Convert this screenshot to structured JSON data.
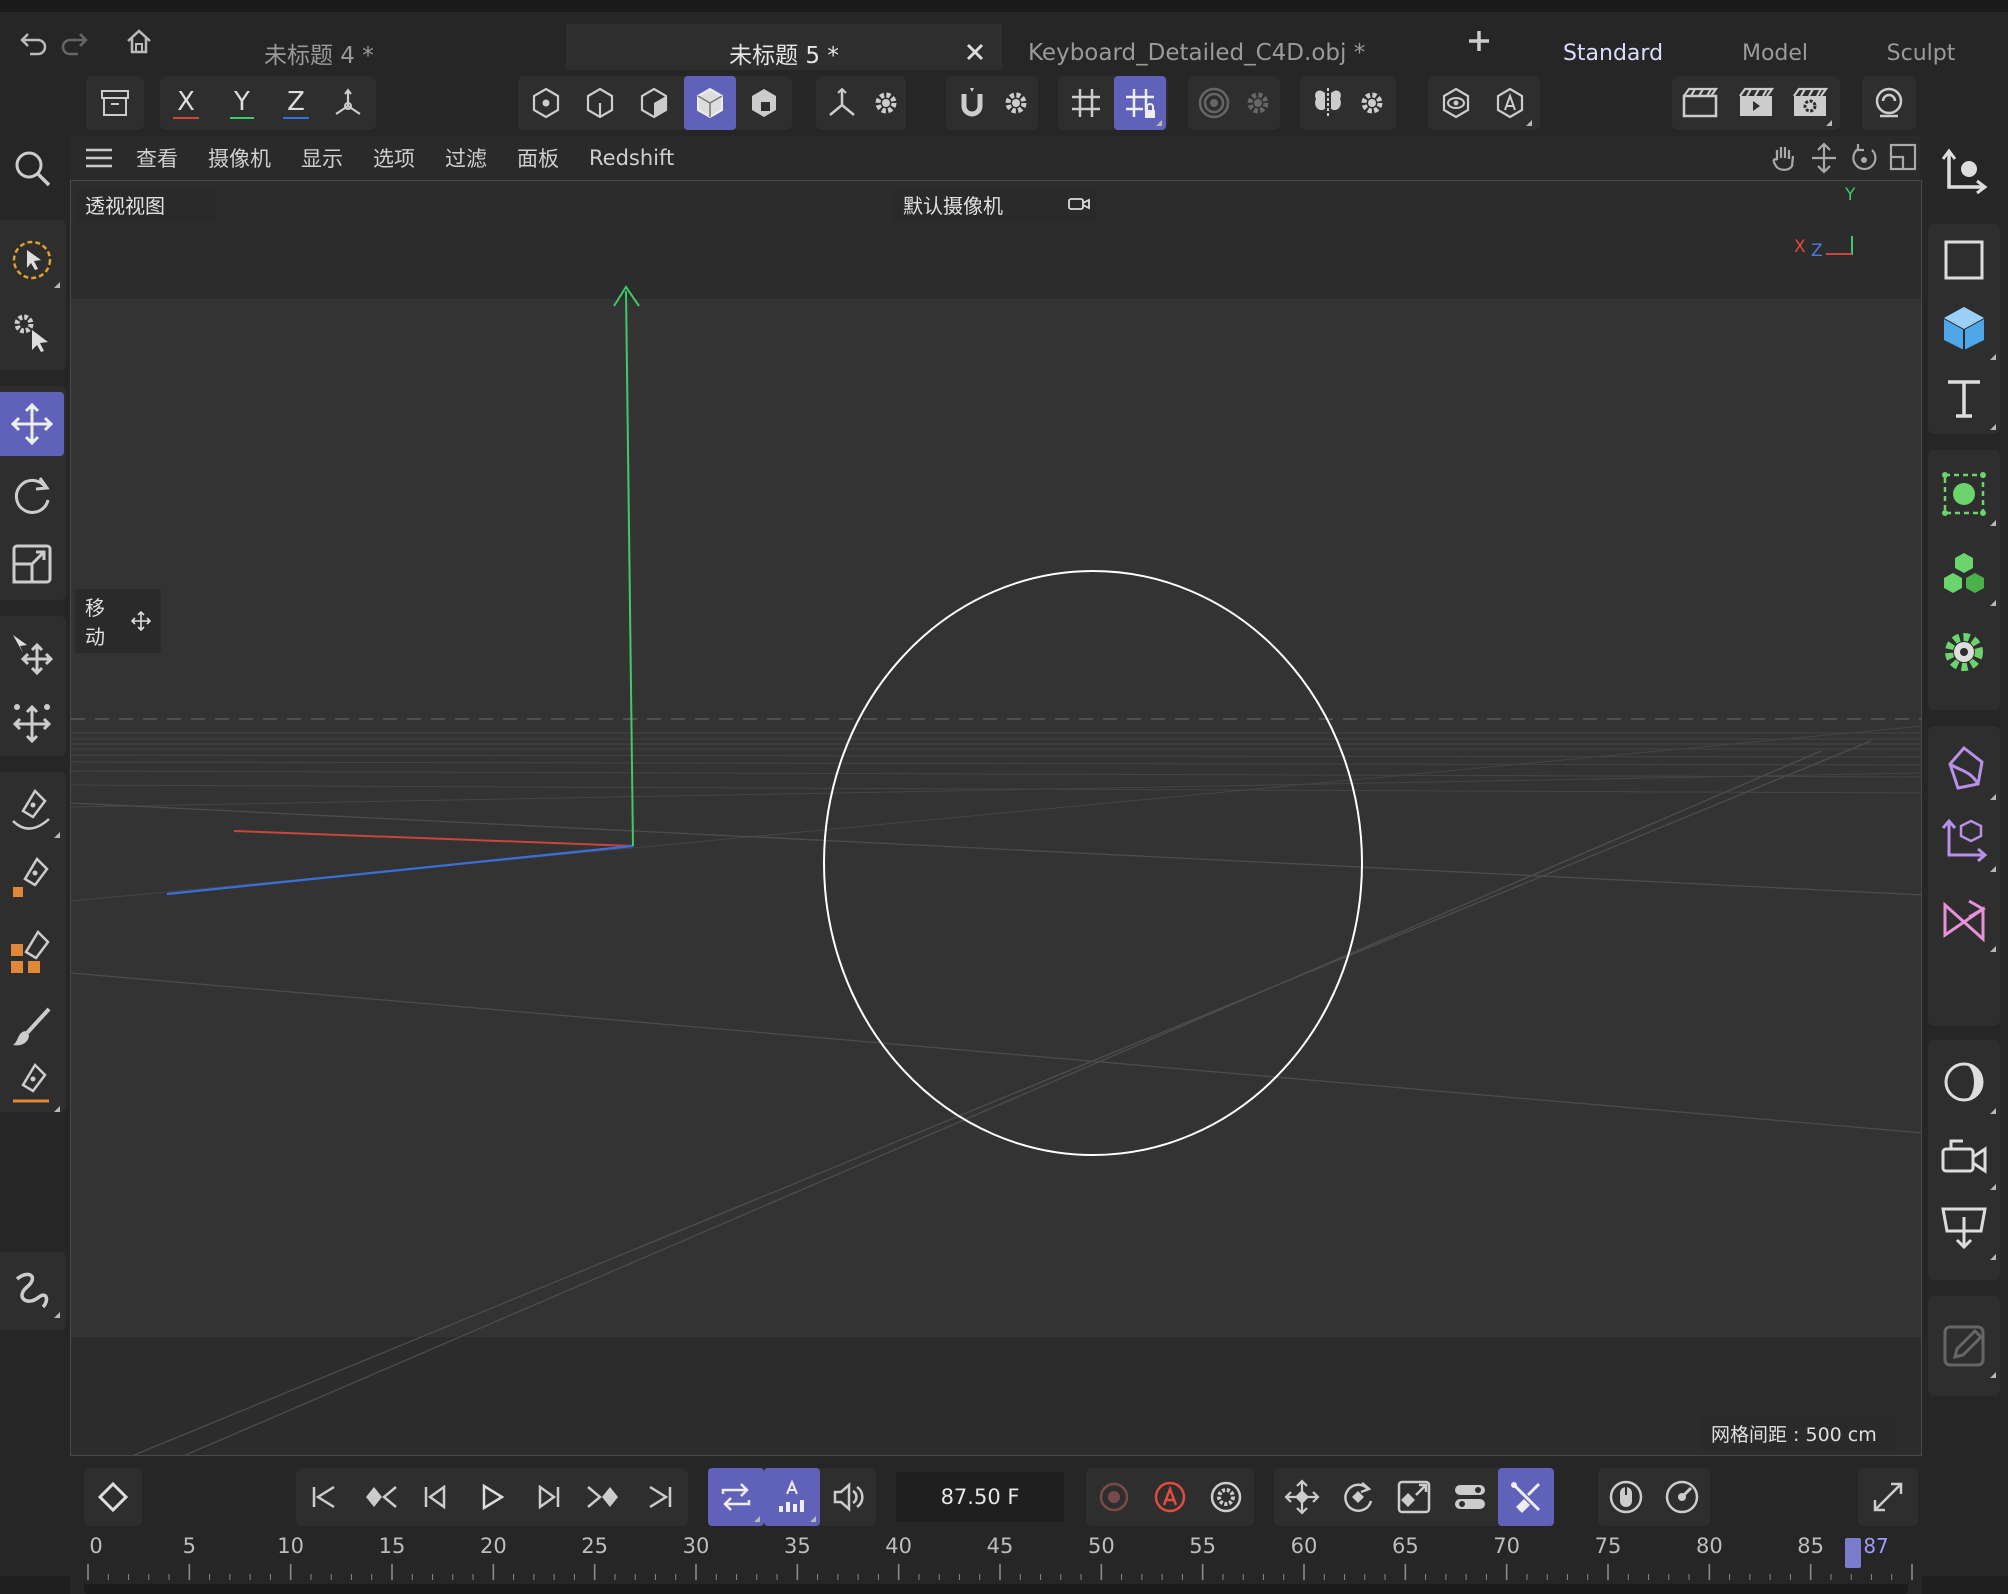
{
  "tabs": [
    {
      "label": "未标题 4 *"
    },
    {
      "label": "未标题 5 *"
    },
    {
      "label": "Keyboard_Detailed_C4D.obj *"
    }
  ],
  "layouts": [
    "Standard",
    "Model",
    "Sculpt"
  ],
  "toolbar": {
    "x": "X",
    "y": "Y",
    "z": "Z"
  },
  "view_menu": [
    "查看",
    "摄像机",
    "显示",
    "选项",
    "过滤",
    "面板",
    "Redshift"
  ],
  "viewport": {
    "view_name": "透视视图",
    "camera": "默认摄像机",
    "tool_label": "移动",
    "grid_spacing": "网格间距 : 500 cm",
    "axis_y": "Y",
    "axis_x": "X",
    "axis_z": "Z"
  },
  "timeline": {
    "frame": "87.50 F",
    "ticks": [
      "0",
      "5",
      "10",
      "15",
      "20",
      "25",
      "30",
      "35",
      "40",
      "45",
      "50",
      "55",
      "60",
      "65",
      "70",
      "75",
      "80",
      "85"
    ],
    "current": "87",
    "current_value": 87.5,
    "max": 90
  },
  "colors": {
    "accent": "#5f62b8",
    "axis_x": "#d0453d",
    "axis_y": "#3ec96c",
    "axis_z": "#3a6fd8"
  }
}
